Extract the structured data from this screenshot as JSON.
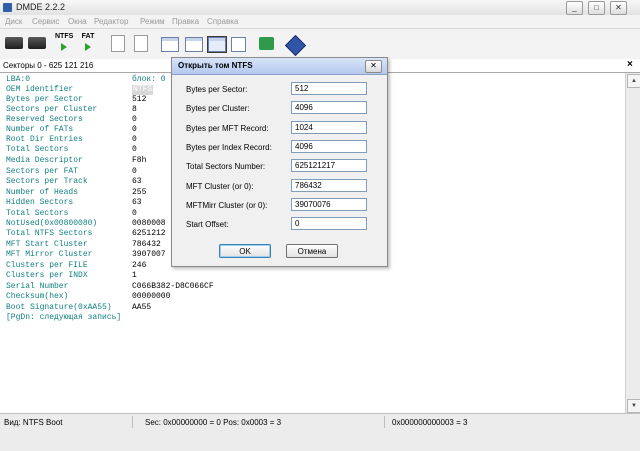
{
  "window": {
    "title": "DMDE 2.2.2",
    "minimize": "_",
    "maximize": "□",
    "close": "✕"
  },
  "menu": [
    "Диск",
    "Сервис",
    "Окна",
    "Редактор",
    "Режим",
    "Правка",
    "Справка"
  ],
  "toolbar": {
    "ntfs_label": "NTFS",
    "fat_label": "FAT"
  },
  "sector_bar": {
    "label": "Секторы 0 - 625 121 216",
    "close": "×"
  },
  "boot_rows": [
    {
      "key": "LBA:0",
      "value": "блок: 0"
    },
    {
      "key": "OEM identifier",
      "value": "NTFS"
    },
    {
      "key": "Bytes per Sector",
      "value": "512"
    },
    {
      "key": "Sectors per Cluster",
      "value": "8"
    },
    {
      "key": "Reserved Sectors",
      "value": "0"
    },
    {
      "key": "Number of FATs",
      "value": "0"
    },
    {
      "key": "Root Dir Entries",
      "value": "0"
    },
    {
      "key": "Total Sectors",
      "value": "0"
    },
    {
      "key": "Media Descriptor",
      "value": "F8h"
    },
    {
      "key": "Sectors per FAT",
      "value": "0"
    },
    {
      "key": "Sectors per Track",
      "value": "63"
    },
    {
      "key": "Number of Heads",
      "value": "255"
    },
    {
      "key": "Hidden Sectors",
      "value": "63"
    },
    {
      "key": "Total Sectors",
      "value": "0"
    },
    {
      "key": "NotUsed(0x00800080)",
      "value": "0080008"
    },
    {
      "key": "Total NTFS Sectors",
      "value": "6251212"
    },
    {
      "key": "MFT Start Cluster",
      "value": "786432"
    },
    {
      "key": "MFT Mirror Cluster",
      "value": "3907007"
    },
    {
      "key": "Clusters per FILE",
      "value": "246"
    },
    {
      "key": "Clusters per INDX",
      "value": "1"
    },
    {
      "key": "Serial Number",
      "value": "C066B382-D8C066CF"
    },
    {
      "key": "Checksum(hex)",
      "value": "00000000"
    },
    {
      "key": "Boot Signature(0xAA55)",
      "value": "AA55"
    },
    {
      "key": "[PgDn: следующая запись]",
      "value": ""
    }
  ],
  "dialog": {
    "title": "Открыть том NTFS",
    "close": "✕",
    "fields": [
      {
        "label": "Bytes per Sector:",
        "value": "512"
      },
      {
        "label": "Bytes per Cluster:",
        "value": "4096"
      },
      {
        "label": "Bytes per MFT Record:",
        "value": "1024"
      },
      {
        "label": "Bytes per Index Record:",
        "value": "4096"
      },
      {
        "label": "Total Sectors Number:",
        "value": "625121217"
      },
      {
        "label": "MFT Cluster (or 0):",
        "value": "786432"
      },
      {
        "label": "MFTMirr Cluster (or 0):",
        "value": "39070076"
      },
      {
        "label": "Start Offset:",
        "value": "0"
      }
    ],
    "ok_label": "OK",
    "cancel_label": "Отмена"
  },
  "status": {
    "view": "Вид: NTFS Boot",
    "sec_pos": "Sec: 0x00000000 = 0  Pos: 0x0003 = 3",
    "offset": "0x000000000003 = 3"
  }
}
